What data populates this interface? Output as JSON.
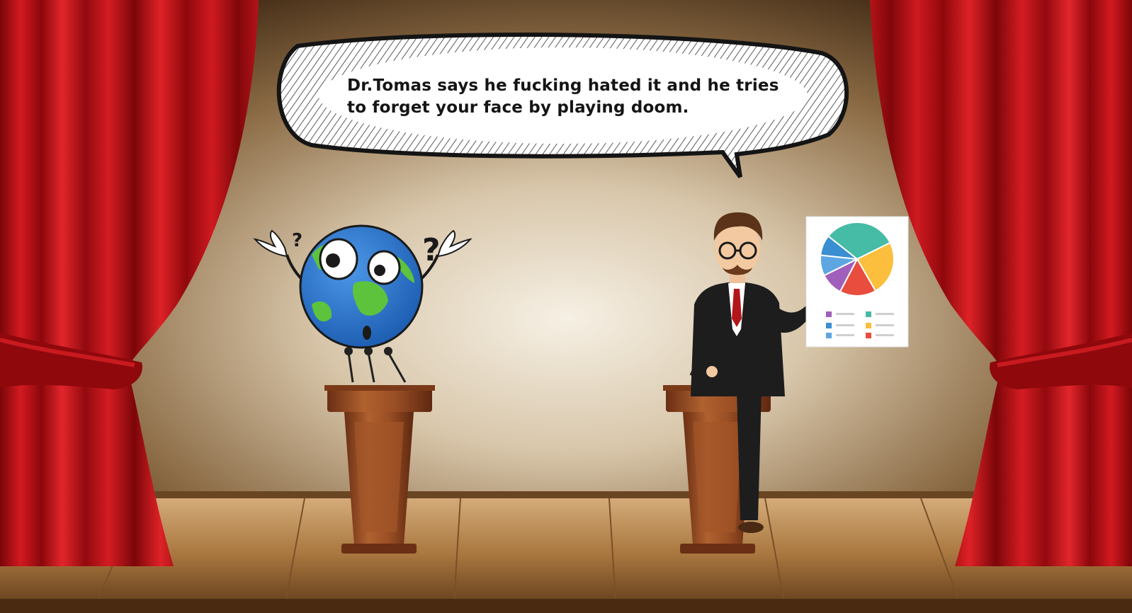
{
  "dialogue": {
    "line1": "Dr.Tomas says he fucking hated it and he tries",
    "line2": "to forget your face by playing doom."
  },
  "colors": {
    "curtain": "#c4141a",
    "curtain_dark": "#6e0508",
    "wall_light": "#f4eee2",
    "wall_dark": "#3a2410",
    "floor": "#9a6a3a",
    "podium": "#8e4622",
    "globe_ocean": "#2c79cf",
    "globe_land": "#5ec33c",
    "suit": "#1d1d1d",
    "tie": "#b2161b"
  },
  "icons": {
    "globe": "confused-globe-icon",
    "presenter": "presenter-man-icon",
    "board": "pie-chart-board-icon"
  },
  "board_chart": {
    "type": "pie",
    "slices": [
      {
        "value": 32,
        "color": "#46bba6"
      },
      {
        "value": 24,
        "color": "#fbbf3d"
      },
      {
        "value": 16,
        "color": "#e84d3d"
      },
      {
        "value": 10,
        "color": "#a05fba"
      },
      {
        "value": 9,
        "color": "#5da6e2"
      },
      {
        "value": 9,
        "color": "#3a8ed2"
      }
    ]
  }
}
